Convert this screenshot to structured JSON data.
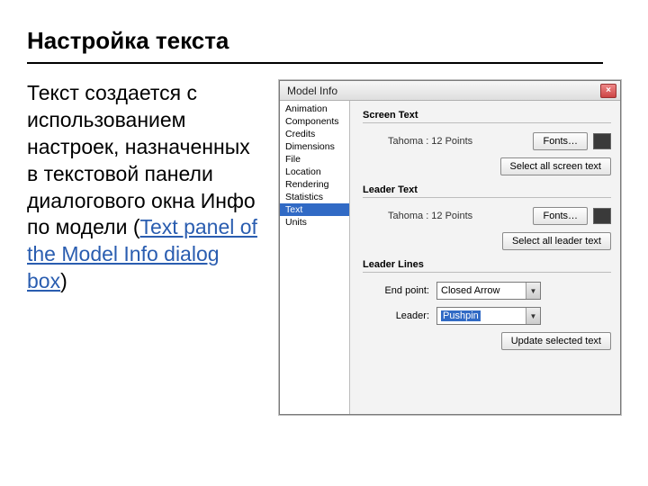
{
  "page": {
    "title": "Настройка текста",
    "description_prefix": "Текст  создается с использованием настроек, назначенных в текстовой панели диалогового окна Инфо по модели (",
    "description_link": "Text panel of the Model Info dialog box",
    "description_suffix": ")"
  },
  "dialog": {
    "title": "Model Info",
    "close_glyph": "×",
    "sidebar": {
      "items": [
        {
          "label": "Animation"
        },
        {
          "label": "Components"
        },
        {
          "label": "Credits"
        },
        {
          "label": "Dimensions"
        },
        {
          "label": "File"
        },
        {
          "label": "Location"
        },
        {
          "label": "Rendering"
        },
        {
          "label": "Statistics"
        },
        {
          "label": "Text",
          "selected": true
        },
        {
          "label": "Units"
        }
      ]
    },
    "panel": {
      "screen_text": {
        "header": "Screen Text",
        "sample": "Tahoma : 12 Points",
        "fonts_button": "Fonts…",
        "select_all_button": "Select all screen text"
      },
      "leader_text": {
        "header": "Leader Text",
        "sample": "Tahoma : 12 Points",
        "fonts_button": "Fonts…",
        "select_all_button": "Select all leader text"
      },
      "leader_lines": {
        "header": "Leader Lines",
        "end_point_label": "End point:",
        "end_point_value": "Closed Arrow",
        "leader_label": "Leader:",
        "leader_value": "Pushpin",
        "update_button": "Update selected text"
      }
    }
  }
}
